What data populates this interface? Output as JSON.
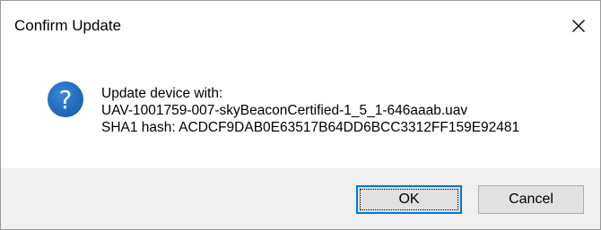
{
  "window": {
    "title": "Confirm Update",
    "close_icon": "close-icon"
  },
  "message": {
    "icon": "question-icon",
    "icon_color": "#1c63b7",
    "lines": [
      "Update device with:",
      "UAV-1001759-007-skyBeaconCertified-1_5_1-646aaab.uav",
      "SHA1 hash: ACDCF9DAB0E63517B64DD6BCC3312FF159E92481"
    ]
  },
  "buttons": {
    "ok_label": "OK",
    "cancel_label": "Cancel",
    "focus_color": "#0078d7"
  }
}
